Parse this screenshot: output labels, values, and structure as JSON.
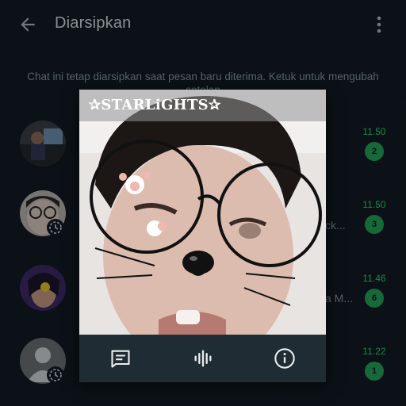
{
  "header": {
    "title": "Diarsipkan",
    "back_icon": "arrow-left-icon",
    "menu_icon": "more-vertical-icon"
  },
  "notice": "Chat ini tetap diarsipkan saat pesan baru diterima. Ketuk untuk mengubah setelan",
  "chats": [
    {
      "time": "11.50",
      "unread": "2",
      "preview": ""
    },
    {
      "time": "11.50",
      "unread": "3",
      "preview": "ck..."
    },
    {
      "time": "11.46",
      "unread": "6",
      "preview": "a M..."
    },
    {
      "time": "11.22",
      "unread": "1",
      "preview": ""
    }
  ],
  "popup": {
    "name": "✰STARLiGHTS✰",
    "actions": [
      {
        "icon": "message-icon"
      },
      {
        "icon": "audio-call-icon"
      },
      {
        "icon": "info-icon"
      }
    ]
  },
  "colors": {
    "background": "#121b22",
    "accent": "#25d366",
    "badge": "#25a25a",
    "muted_text": "#8696a0"
  }
}
